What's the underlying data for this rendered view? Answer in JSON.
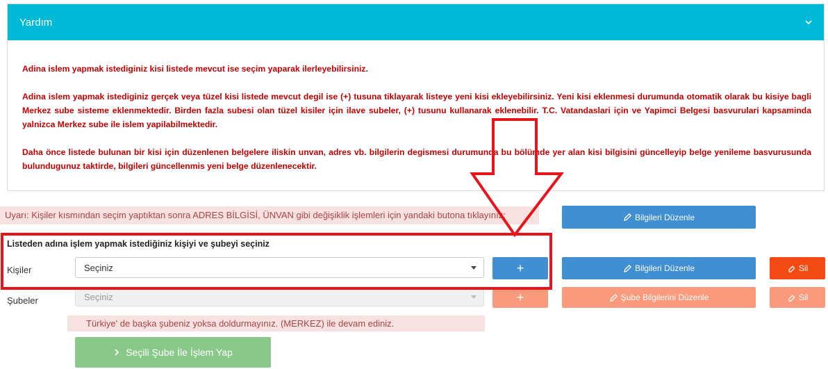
{
  "help": {
    "title": "Yardım",
    "paragraph1": "Adina islem yapmak istediginiz kisi listede mevcut ise seçim yaparak ilerleyebilirsiniz.",
    "paragraph2": "Adina islem yapmak istediginiz gerçek veya tüzel kisi listede mevcut degil ise (+) tusuna tiklayarak listeye yeni kisi ekleyebilirsiniz. Yeni kisi eklenmesi durumunda otomatik olarak bu kisiye bagli Merkez sube sisteme eklenmektedir. Birden fazla subesi olan tüzel kisiler için ilave subeler, (+) tusunu kullanarak eklenebilir. T.C. Vatandaslari için ve Yapimci Belgesi basvurulari kapsaminda yalnizca Merkez sube ile islem yapilabilmektedir.",
    "paragraph3": "Daha önce listede bulunan bir kisi için düzenlenen belgelere iliskin unvan, adres vb. bilgilerin degismesi durumunda bu bölümde yer alan kisi bilgisini güncelleyip belge yenileme basvurusunda bulundugunuz taktirde, bilgileri güncellenmis yeni belge düzenlenecektir."
  },
  "warning": "Uyarı: Kişiler kısmından seçim yaptıktan sonra ADRES BİLGİSİ, ÜNVAN gibi değişiklik işlemleri için yandaki butona tıklayınız:",
  "top_edit_button": "Bilgileri Düzenle",
  "section_title": "Listeden adına işlem yapmak istediğiniz kişiyi ve şubeyi seçiniz",
  "persons": {
    "label": "Kişiler",
    "selected": "Seçiniz",
    "add_button": "+",
    "edit_button": "Bilgileri Düzenle",
    "delete_button": "Sil"
  },
  "branches": {
    "label": "Şubeler",
    "selected": "Seçiniz",
    "add_button": "+",
    "edit_button": "Şube Bilgilerini Düzenle",
    "delete_button": "Sil"
  },
  "branch_note": "Türkiye' de başka şubeniz yoksa doldurmayınız. (MERKEZ) ile devam ediniz.",
  "proceed_button": "Seçili Şube İle İşlem Yap",
  "colors": {
    "header": "#00b9d6",
    "help_text": "#c40000",
    "primary": "#3f8fd2",
    "danger": "#f44b14",
    "highlight": "#e8141c"
  }
}
